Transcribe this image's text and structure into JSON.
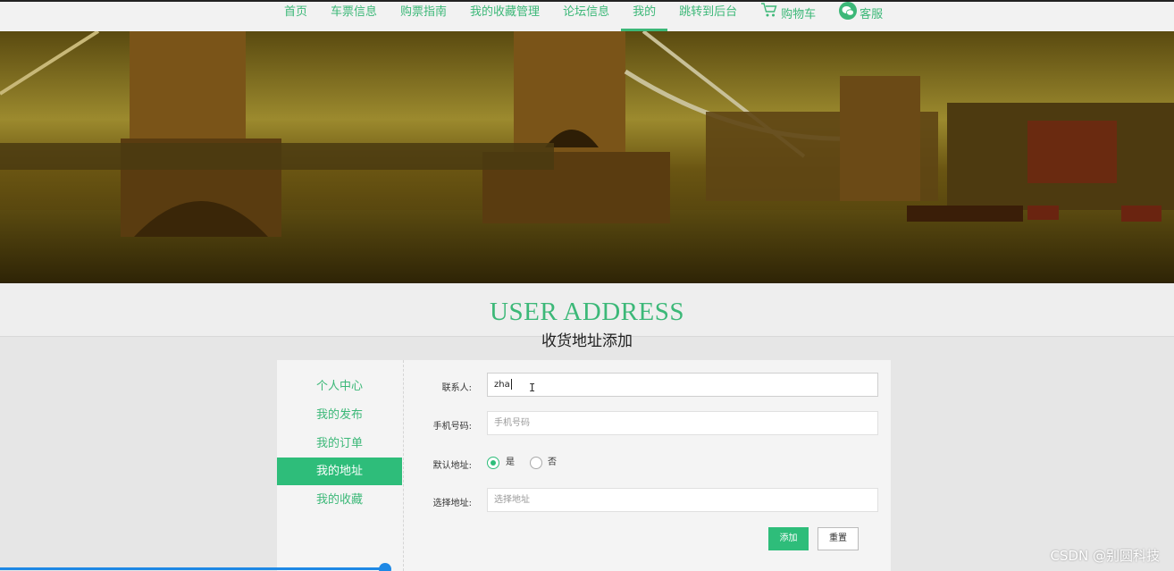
{
  "nav": {
    "items": [
      {
        "label": "首页"
      },
      {
        "label": "车票信息"
      },
      {
        "label": "购票指南"
      },
      {
        "label": "我的收藏管理"
      },
      {
        "label": "论坛信息"
      },
      {
        "label": "我的",
        "active": true
      },
      {
        "label": "跳转到后台"
      },
      {
        "label": "购物车",
        "icon": "cart-icon"
      },
      {
        "label": "客服",
        "icon": "wechat-icon"
      }
    ]
  },
  "heading": {
    "en": "USER ADDRESS",
    "zh": "收货地址添加"
  },
  "sidebar": {
    "items": [
      {
        "label": "个人中心"
      },
      {
        "label": "我的发布"
      },
      {
        "label": "我的订单"
      },
      {
        "label": "我的地址",
        "active": true
      },
      {
        "label": "我的收藏"
      }
    ]
  },
  "form": {
    "contact": {
      "label": "联系人:",
      "value": "zha"
    },
    "phone": {
      "label": "手机号码:",
      "placeholder": "手机号码"
    },
    "default_address": {
      "label": "默认地址:",
      "options": [
        "是",
        "否"
      ],
      "selected": "是"
    },
    "address": {
      "label": "选择地址:",
      "placeholder": "选择地址"
    },
    "add_label": "添加",
    "reset_label": "重置"
  },
  "watermark": "CSDN @别圆科技",
  "colors": {
    "accent": "#2ebd7a",
    "nav_text": "#3cb878"
  }
}
